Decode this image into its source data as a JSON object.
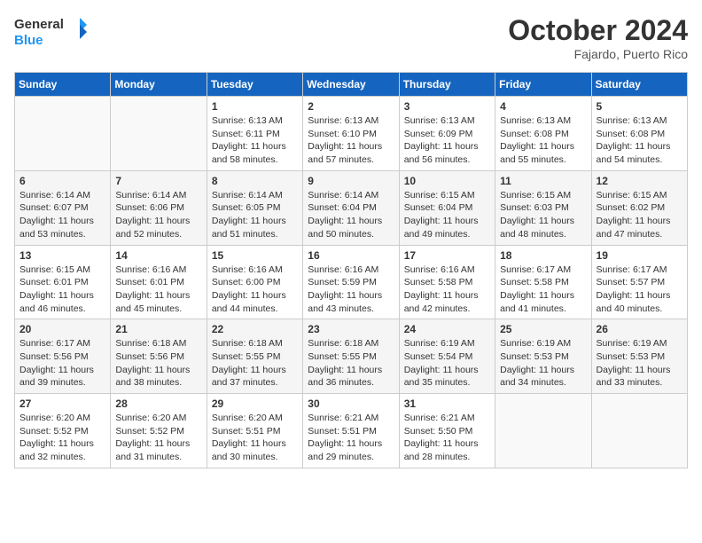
{
  "header": {
    "logo_general": "General",
    "logo_blue": "Blue",
    "month_year": "October 2024",
    "location": "Fajardo, Puerto Rico"
  },
  "weekdays": [
    "Sunday",
    "Monday",
    "Tuesday",
    "Wednesday",
    "Thursday",
    "Friday",
    "Saturday"
  ],
  "weeks": [
    [
      {
        "day": "",
        "info": ""
      },
      {
        "day": "",
        "info": ""
      },
      {
        "day": "1",
        "info": "Sunrise: 6:13 AM\nSunset: 6:11 PM\nDaylight: 11 hours and 58 minutes."
      },
      {
        "day": "2",
        "info": "Sunrise: 6:13 AM\nSunset: 6:10 PM\nDaylight: 11 hours and 57 minutes."
      },
      {
        "day": "3",
        "info": "Sunrise: 6:13 AM\nSunset: 6:09 PM\nDaylight: 11 hours and 56 minutes."
      },
      {
        "day": "4",
        "info": "Sunrise: 6:13 AM\nSunset: 6:08 PM\nDaylight: 11 hours and 55 minutes."
      },
      {
        "day": "5",
        "info": "Sunrise: 6:13 AM\nSunset: 6:08 PM\nDaylight: 11 hours and 54 minutes."
      }
    ],
    [
      {
        "day": "6",
        "info": "Sunrise: 6:14 AM\nSunset: 6:07 PM\nDaylight: 11 hours and 53 minutes."
      },
      {
        "day": "7",
        "info": "Sunrise: 6:14 AM\nSunset: 6:06 PM\nDaylight: 11 hours and 52 minutes."
      },
      {
        "day": "8",
        "info": "Sunrise: 6:14 AM\nSunset: 6:05 PM\nDaylight: 11 hours and 51 minutes."
      },
      {
        "day": "9",
        "info": "Sunrise: 6:14 AM\nSunset: 6:04 PM\nDaylight: 11 hours and 50 minutes."
      },
      {
        "day": "10",
        "info": "Sunrise: 6:15 AM\nSunset: 6:04 PM\nDaylight: 11 hours and 49 minutes."
      },
      {
        "day": "11",
        "info": "Sunrise: 6:15 AM\nSunset: 6:03 PM\nDaylight: 11 hours and 48 minutes."
      },
      {
        "day": "12",
        "info": "Sunrise: 6:15 AM\nSunset: 6:02 PM\nDaylight: 11 hours and 47 minutes."
      }
    ],
    [
      {
        "day": "13",
        "info": "Sunrise: 6:15 AM\nSunset: 6:01 PM\nDaylight: 11 hours and 46 minutes."
      },
      {
        "day": "14",
        "info": "Sunrise: 6:16 AM\nSunset: 6:01 PM\nDaylight: 11 hours and 45 minutes."
      },
      {
        "day": "15",
        "info": "Sunrise: 6:16 AM\nSunset: 6:00 PM\nDaylight: 11 hours and 44 minutes."
      },
      {
        "day": "16",
        "info": "Sunrise: 6:16 AM\nSunset: 5:59 PM\nDaylight: 11 hours and 43 minutes."
      },
      {
        "day": "17",
        "info": "Sunrise: 6:16 AM\nSunset: 5:58 PM\nDaylight: 11 hours and 42 minutes."
      },
      {
        "day": "18",
        "info": "Sunrise: 6:17 AM\nSunset: 5:58 PM\nDaylight: 11 hours and 41 minutes."
      },
      {
        "day": "19",
        "info": "Sunrise: 6:17 AM\nSunset: 5:57 PM\nDaylight: 11 hours and 40 minutes."
      }
    ],
    [
      {
        "day": "20",
        "info": "Sunrise: 6:17 AM\nSunset: 5:56 PM\nDaylight: 11 hours and 39 minutes."
      },
      {
        "day": "21",
        "info": "Sunrise: 6:18 AM\nSunset: 5:56 PM\nDaylight: 11 hours and 38 minutes."
      },
      {
        "day": "22",
        "info": "Sunrise: 6:18 AM\nSunset: 5:55 PM\nDaylight: 11 hours and 37 minutes."
      },
      {
        "day": "23",
        "info": "Sunrise: 6:18 AM\nSunset: 5:55 PM\nDaylight: 11 hours and 36 minutes."
      },
      {
        "day": "24",
        "info": "Sunrise: 6:19 AM\nSunset: 5:54 PM\nDaylight: 11 hours and 35 minutes."
      },
      {
        "day": "25",
        "info": "Sunrise: 6:19 AM\nSunset: 5:53 PM\nDaylight: 11 hours and 34 minutes."
      },
      {
        "day": "26",
        "info": "Sunrise: 6:19 AM\nSunset: 5:53 PM\nDaylight: 11 hours and 33 minutes."
      }
    ],
    [
      {
        "day": "27",
        "info": "Sunrise: 6:20 AM\nSunset: 5:52 PM\nDaylight: 11 hours and 32 minutes."
      },
      {
        "day": "28",
        "info": "Sunrise: 6:20 AM\nSunset: 5:52 PM\nDaylight: 11 hours and 31 minutes."
      },
      {
        "day": "29",
        "info": "Sunrise: 6:20 AM\nSunset: 5:51 PM\nDaylight: 11 hours and 30 minutes."
      },
      {
        "day": "30",
        "info": "Sunrise: 6:21 AM\nSunset: 5:51 PM\nDaylight: 11 hours and 29 minutes."
      },
      {
        "day": "31",
        "info": "Sunrise: 6:21 AM\nSunset: 5:50 PM\nDaylight: 11 hours and 28 minutes."
      },
      {
        "day": "",
        "info": ""
      },
      {
        "day": "",
        "info": ""
      }
    ]
  ]
}
